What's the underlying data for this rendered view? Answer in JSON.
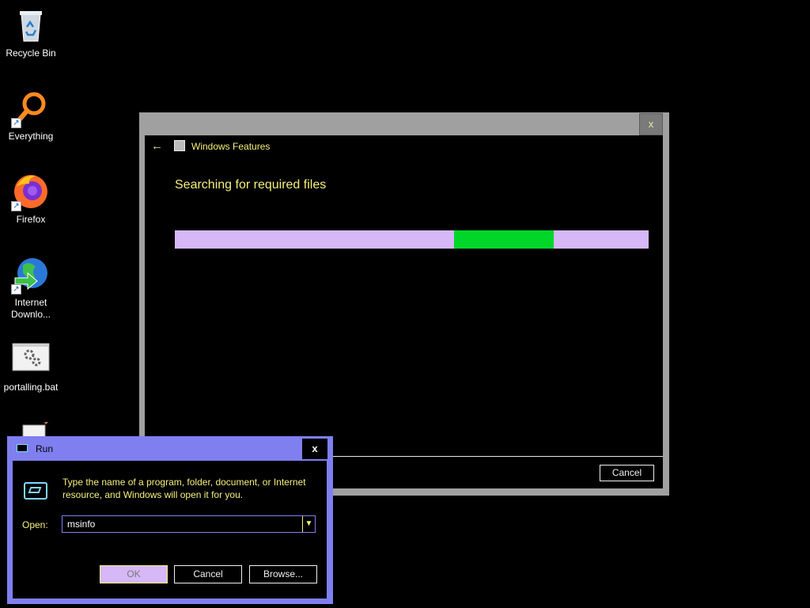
{
  "desktop": {
    "icons": [
      {
        "label": "Recycle Bin",
        "icon": "recycle-bin-icon"
      },
      {
        "label": "Everything",
        "icon": "search-magnifier-icon"
      },
      {
        "label": "Firefox",
        "icon": "firefox-icon"
      },
      {
        "label": "Internet Downlo...",
        "label_line1": "Internet",
        "label_line2": "Downlo...",
        "icon": "globe-download-icon"
      },
      {
        "label": "portalling.bat",
        "icon": "batch-file-gear-icon"
      },
      {
        "label": "",
        "icon": "notepad-file-icon"
      }
    ]
  },
  "windows_features": {
    "title": "Windows Features",
    "heading": "Searching for required files",
    "progress": {
      "indeterminate": true,
      "chunk_start_fraction": 0.59,
      "chunk_end_fraction": 0.8
    },
    "cancel_label": "Cancel",
    "close_label": "x"
  },
  "run_dialog": {
    "title": "Run",
    "close_label": "x",
    "description": "Type the name of a program, folder, document, or Internet resource, and Windows will open it for you.",
    "open_label": "Open:",
    "open_value": "msinfo",
    "ok_label": "OK",
    "cancel_label": "Cancel",
    "browse_label": "Browse..."
  },
  "colors": {
    "accent_yellow": "#f5f07a",
    "progress_track": "#d5b8f5",
    "progress_chunk": "#00d62a",
    "run_frame": "#7f7ff0"
  }
}
